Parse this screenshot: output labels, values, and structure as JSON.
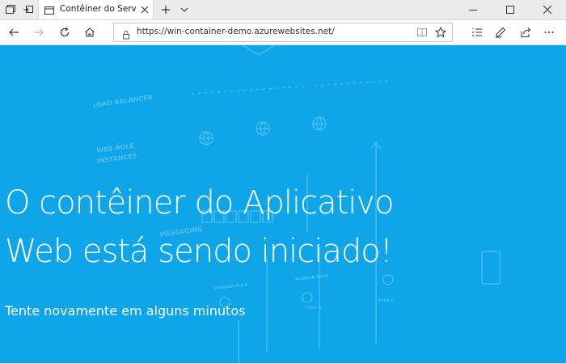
{
  "browser": {
    "tab_title": "Contêiner do Serviço de Aplicativo",
    "url": "https://win-container-demo.azurewebsites.net/"
  },
  "page": {
    "headline_line1": "O contêiner do Aplicativo",
    "headline_line2": "Web está sendo iniciado!",
    "subtitle": "Tente novamente em alguns minutos",
    "background_labels": [
      "LOAD BALANCER",
      "WEB ROLE",
      "INSTANCES",
      "MESSAGING",
      "WORKER ROLE",
      "WORKER ROLE",
      "TYPE A",
      "TYPE C"
    ]
  },
  "icons": [
    "tab-list-icon",
    "restore-tabs-icon",
    "page-icon",
    "close-icon",
    "plus-icon",
    "chevron-down-icon",
    "minimize-icon",
    "maximize-icon",
    "back-icon",
    "forward-icon",
    "refresh-icon",
    "home-icon",
    "lock-icon",
    "reading-view-icon",
    "favorite-star-icon",
    "favorites-list-icon",
    "pen-icon",
    "share-icon",
    "more-icon"
  ],
  "colors": {
    "page_background": "#0ea6e8",
    "title_bar": "#ececec",
    "text": "#ffffff"
  }
}
